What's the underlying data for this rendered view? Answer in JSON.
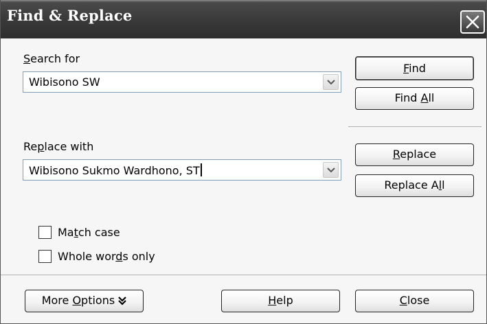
{
  "window": {
    "title": "Find & Replace"
  },
  "search": {
    "label": "Search for",
    "value": "Wibisono SW"
  },
  "replace": {
    "label": "Replace with",
    "value": "Wibisono Sukmo Wardhono, ST"
  },
  "buttons": {
    "find": "Find",
    "find_all": "Find All",
    "replace": "Replace",
    "replace_all": "Replace All",
    "more_options": "More Options",
    "help": "Help",
    "close": "Close"
  },
  "options": {
    "match_case": {
      "label": "Match case",
      "checked": false
    },
    "whole_words": {
      "label": "Whole words only",
      "checked": false
    }
  },
  "icons": [
    "close-icon",
    "dropdown-arrow-icon",
    "double-chevron-down-icon"
  ]
}
